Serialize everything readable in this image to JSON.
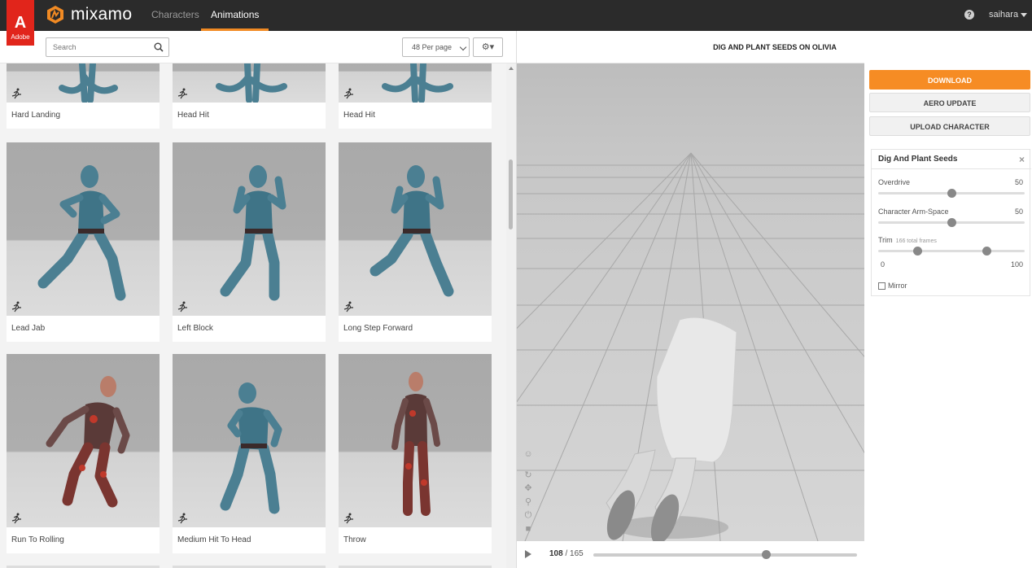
{
  "header": {
    "brand_badge": "Adobe",
    "brand_glyph": "A",
    "logo_text": "mixamo",
    "tabs": [
      {
        "label": "Characters"
      },
      {
        "label": "Animations"
      }
    ],
    "help_label": "?",
    "username": "saihara",
    "accent_color": "#f18a23"
  },
  "toolbar": {
    "search_placeholder": "Search",
    "per_page": "48 Per page",
    "settings_icon": "gear-icon"
  },
  "animations": [
    {
      "name": "Hard Landing"
    },
    {
      "name": "Head Hit"
    },
    {
      "name": "Head Hit"
    },
    {
      "name": "Lead Jab"
    },
    {
      "name": "Left Block"
    },
    {
      "name": "Long Step Forward"
    },
    {
      "name": "Run To Rolling"
    },
    {
      "name": "Medium Hit To Head"
    },
    {
      "name": "Throw"
    }
  ],
  "viewer": {
    "title": "DIG AND PLANT SEEDS ON OLIVIA",
    "current_frame": "108",
    "frame_separator": " / ",
    "total_frames": "165",
    "timeline_progress": 0.655
  },
  "sidebar": {
    "download_label": "DOWNLOAD",
    "aero_label": "AERO UPDATE",
    "upload_label": "UPLOAD CHARACTER",
    "panel_title": "Dig And Plant Seeds",
    "close_glyph": "×",
    "params": [
      {
        "label": "Overdrive",
        "value": "50",
        "fraction": 0.5
      },
      {
        "label": "Character Arm-Space",
        "value": "50",
        "fraction": 0.5
      }
    ],
    "trim": {
      "label": "Trim",
      "note": "166 total frames",
      "min": "0",
      "max": "100",
      "start_fraction": 0.27,
      "end_fraction": 0.74
    },
    "mirror_label": "Mirror"
  }
}
